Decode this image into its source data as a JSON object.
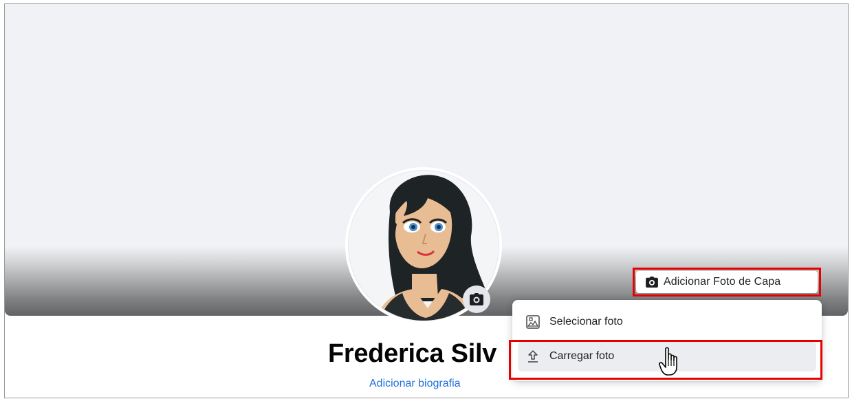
{
  "profile": {
    "name": "Frederica Silv",
    "bio_link": "Adicionar biografia"
  },
  "cover": {
    "add_cover_label": "Adicionar Foto de Capa"
  },
  "menu": {
    "items": [
      {
        "label": "Selecionar foto",
        "icon": "photo-select-icon"
      },
      {
        "label": "Carregar foto",
        "icon": "upload-icon"
      }
    ]
  },
  "colors": {
    "highlight": "#e60000",
    "link": "#216fdb",
    "cover_bg": "#f0f2f5",
    "hover_bg": "#ebedf0"
  }
}
